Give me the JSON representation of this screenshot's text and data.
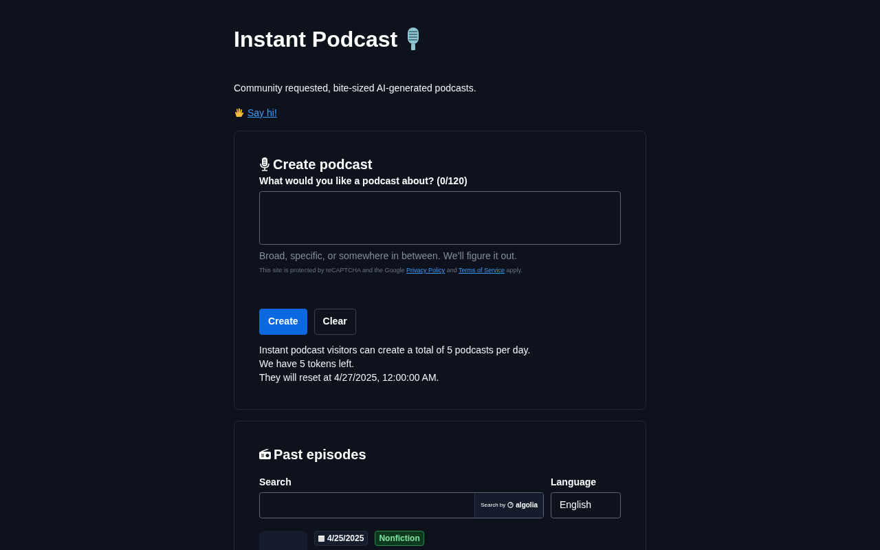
{
  "header": {
    "title": "Instant Podcast",
    "tagline": "Community requested, bite-sized AI-generated podcasts.",
    "contact_link": "Say hi!"
  },
  "create": {
    "heading": "Create podcast",
    "label": "What would you like a podcast about? (0/120)",
    "hint": "Broad, specific, or somewhere in between. We’ll figure it out.",
    "recaptcha": {
      "before": "This site is protected by reCAPTCHA and the Google",
      "privacy_link": "Privacy Policy",
      "middle": "and",
      "terms_link": "Terms of Service",
      "after": "apply."
    },
    "buttons": [
      {
        "label": "Create",
        "kind": "primary"
      },
      {
        "label": "Clear",
        "kind": "secondary"
      }
    ],
    "quota_lines": [
      "Instant podcast visitors can create a total of 5 podcasts per day.",
      "We have 5 tokens left.",
      "They will reset at 4/27/2025, 12:00:00 AM."
    ]
  },
  "past": {
    "heading": "Past episodes",
    "search_label": "Search",
    "search_badge": {
      "prefix": "Search by",
      "brand": "algolia"
    },
    "language_label": "Language",
    "language": "English",
    "episodes": [
      {
        "date": "4/25/2025",
        "genre": "Nonfiction"
      }
    ]
  }
}
